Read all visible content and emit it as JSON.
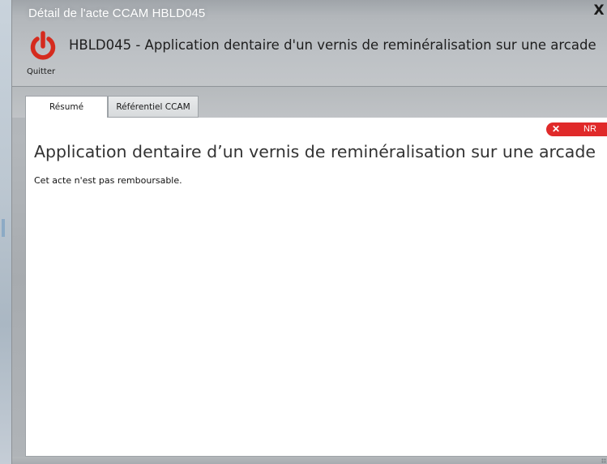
{
  "window": {
    "title": "Détail de l'acte CCAM HBLD045",
    "close_label": "X"
  },
  "toolbar": {
    "quit_label": "Quitter",
    "quit_icon": "power-icon"
  },
  "header": {
    "title": "HBLD045 - Application dentaire d'un vernis de reminéralisation sur une arcade"
  },
  "tabs": [
    {
      "label": "Résumé",
      "active": true
    },
    {
      "label": "Référentiel CCAM",
      "active": false
    }
  ],
  "content": {
    "badge": {
      "icon": "x-icon",
      "label": "NR",
      "color": "#e02a2a"
    },
    "act_title": "Application dentaire d’un vernis de reminéralisation sur une arcade",
    "note": "Cet acte n'est pas remboursable."
  },
  "colors": {
    "accent_red": "#d52b1e",
    "title_text": "#ffffff"
  }
}
